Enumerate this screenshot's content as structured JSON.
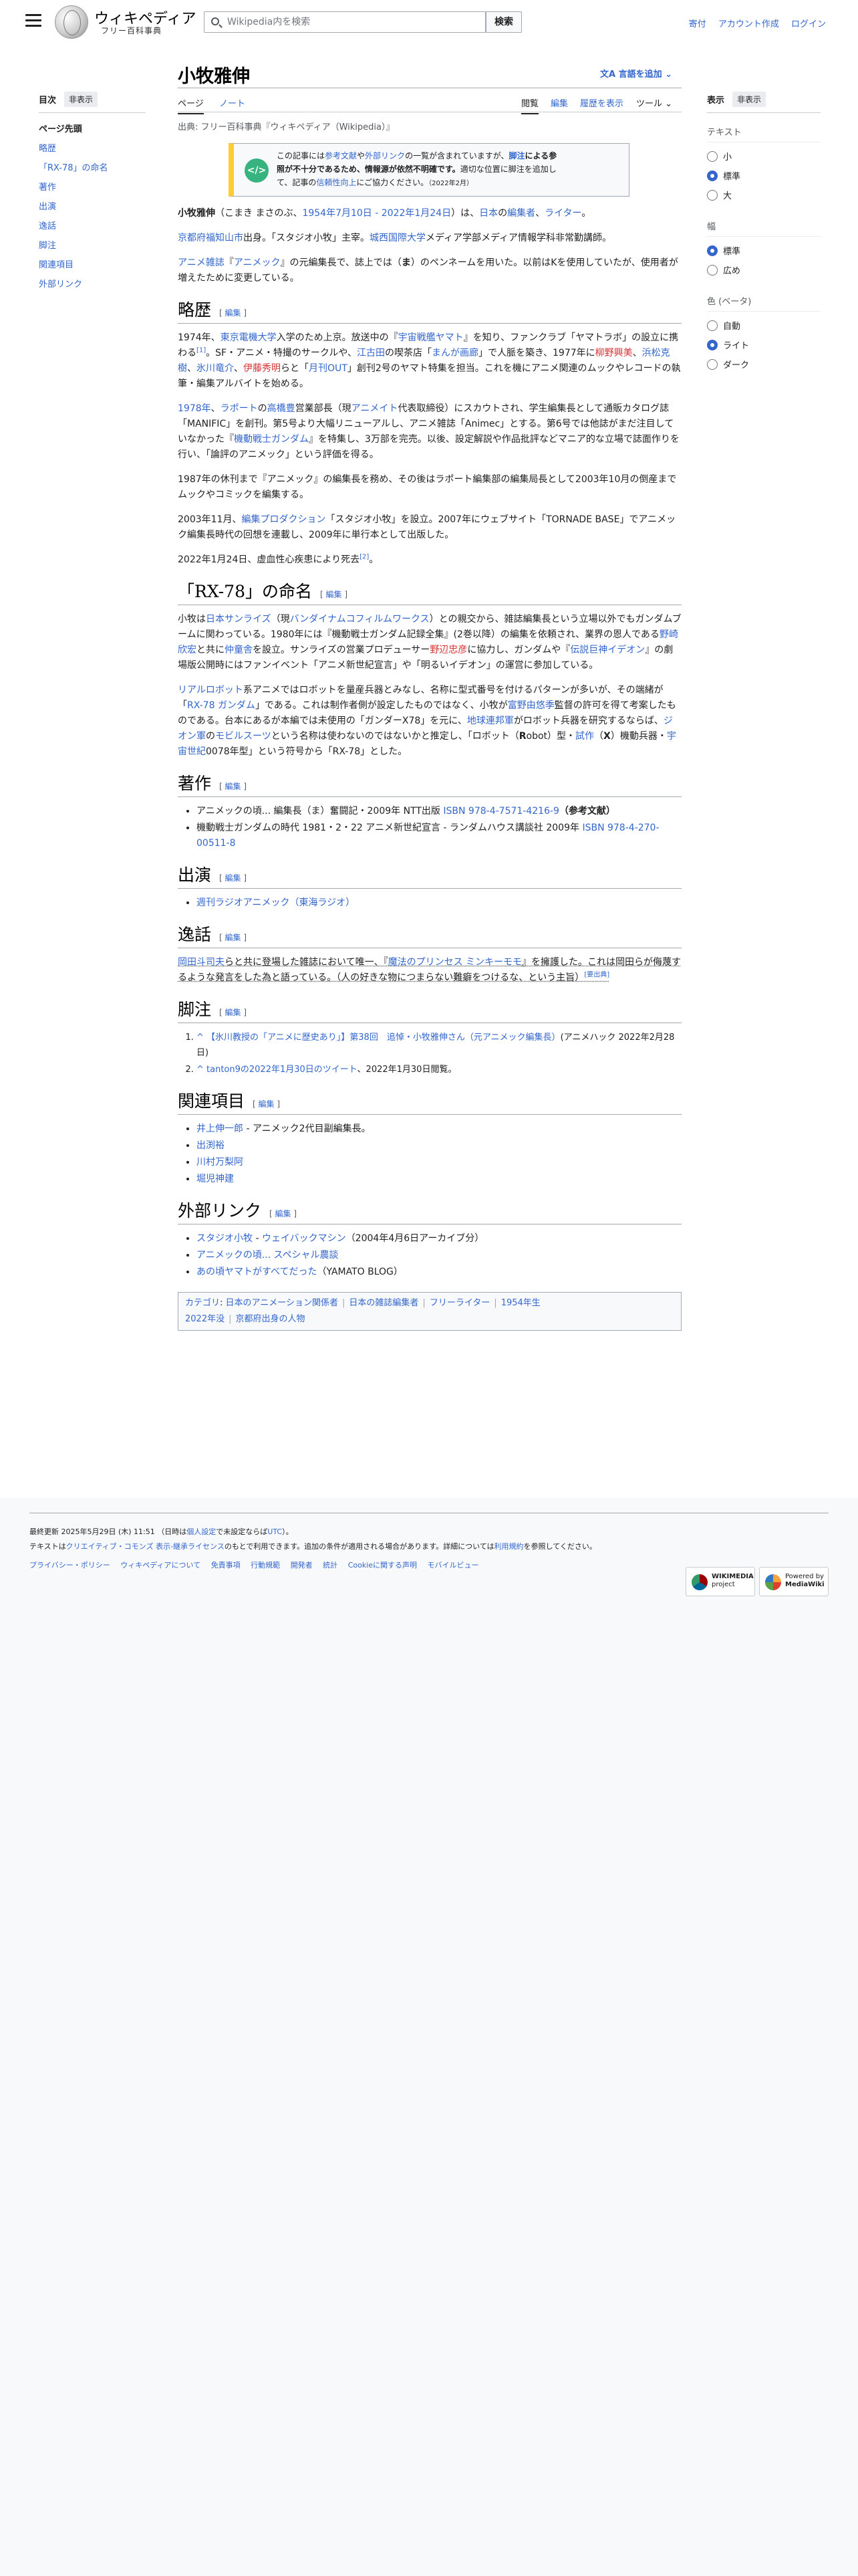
{
  "header": {
    "logo_title": "ウィキペディア",
    "logo_sub": "フリー百科事典",
    "search_placeholder": "Wikipedia内を検索",
    "search_button": "検索",
    "links": [
      "寄付",
      "アカウント作成",
      "ログイン"
    ]
  },
  "toc": {
    "title": "目次",
    "hide": "非表示",
    "items": [
      "ページ先頭",
      "略歴",
      "「RX-78」の命名",
      "著作",
      "出演",
      "逸話",
      "脚注",
      "関連項目",
      "外部リンク"
    ]
  },
  "display_panel": {
    "title": "表示",
    "hide": "非表示",
    "text_group": "テキスト",
    "text_options": [
      "小",
      "標準",
      "大"
    ],
    "width_group": "幅",
    "width_options": [
      "標準",
      "広め"
    ],
    "color_group": "色 (ベータ)",
    "color_options": [
      "自動",
      "ライト",
      "ダーク"
    ]
  },
  "article": {
    "title": "小牧雅伸",
    "lang_button": "言語を追加",
    "tabs": {
      "page": "ページ",
      "talk": "ノート",
      "read": "閲覧",
      "edit": "編集",
      "history": "履歴を表示",
      "tools": "ツール"
    },
    "source": "出典: フリー百科事典『ウィキペディア（Wikipedia）』",
    "notice": {
      "icon": "</>",
      "l1a": "この記事には",
      "l1b": "参考文献",
      "l1c": "や",
      "l1d": "外部リンク",
      "l1e": "の一覧が含まれていますが、",
      "l1f": "脚注",
      "l1g": "による参",
      "l2": "照が不十分であるため、情報源が依然不明確です。",
      "l2b": "適切な位置に脚注を追加し",
      "l3a": "て、記事の",
      "l3b": "信頼性向上",
      "l3c": "にご協力ください。",
      "date": "（2022年2月）"
    },
    "lead": {
      "name": "小牧雅伸",
      "reading": "（こまき まさのぶ、",
      "dates": "1954年7月10日 - 2022年1月24日",
      "mid": "）は、",
      "country": "日本",
      "of": "の",
      "job1": "編集者",
      "sep": "、",
      "job2": "ライター",
      "end": "。"
    },
    "p2": {
      "a": "京都府福知山市",
      "b": "出身。「スタジオ小牧」主宰。",
      "c": "城西国際大学",
      "d": "メディア学部メディア情報学科非常勤講師。"
    },
    "p3": {
      "a": "アニメ雑誌",
      "b": "『",
      "c": "アニメック",
      "d": "』の元編集長で、誌上では（",
      "e": "ま",
      "f": "）のペンネームを用いた。以前はKを使用していたが、使用者が増えたために変更している。"
    },
    "s1": {
      "h": "略歴",
      "edit": "編集",
      "p1a": "1974年、",
      "p1b": "東京電機大学",
      "p1c": "入学のため上京。放送中の『",
      "p1d": "宇宙戦艦ヤマト",
      "p1e": "』を知り、ファンクラブ「ヤマトラボ」の設立に携わる",
      "p1f": "[1]",
      "p1g": "。SF・アニメ・特撮のサークルや、",
      "p1h": "江古田",
      "p1i": "の喫茶店「",
      "p1j": "まんが画廊",
      "p1k": "」で人脈を築き、1977年に",
      "p1l": "柳野興美",
      "p1m": "、",
      "p1n": "浜松克樹",
      "p1o": "、",
      "p1p": "氷川竜介",
      "p1q": "、",
      "p1r": "伊藤秀明",
      "p1s": "らと「",
      "p1t": "月刊OUT",
      "p1u": "」創刊2号のヤマト特集を担当。これを機にアニメ関連のムックやレコードの執筆・編集アルバイトを始める。",
      "p2a": "1978年",
      "p2b": "、",
      "p2c": "ラポート",
      "p2d": "の",
      "p2e": "高橋豊",
      "p2f": "営業部長（現",
      "p2g": "アニメイト",
      "p2h": "代表取締役）にスカウトされ、学生編集長として通販カタログ誌「MANIFIC」を創刊。第5号より大幅リニューアルし、アニメ雑誌「Animec」とする。第6号では他誌がまだ注目していなかった『",
      "p2i": "機動戦士ガンダム",
      "p2j": "』を特集し、3万部を完売。以後、設定解説や作品批評などマニア的な立場で誌面作りを行い、「論評のアニメック」という評価を得る。",
      "p3": "1987年の休刊まで『アニメック』の編集長を務め、その後はラポート編集部の編集局長として2003年10月の倒産までムックやコミックを編集する。",
      "p4a": "2003年11月、",
      "p4b": "編集プロダクション",
      "p4c": "「スタジオ小牧」を設立。2007年にウェブサイト「TORNADE BASE」でアニメック編集長時代の回想を連載し、2009年に単行本として出版した。",
      "p5a": "2022年1月24日、虚血性心疾患により死去",
      "p5b": "[2]",
      "p5c": "。"
    },
    "s2": {
      "h": "「RX-78」の命名",
      "edit": "編集",
      "p1a": "小牧は",
      "p1b": "日本サンライズ",
      "p1c": "（現",
      "p1d": "バンダイナムコフィルムワークス",
      "p1e": "）との親交から、雑誌編集長という立場以外でもガンダムブームに関わっている。1980年には『機動戦士ガンダム記録全集』(2巻以降）の編集を依頼され、業界の恩人である",
      "p1f": "野崎欣宏",
      "p1g": "と共に",
      "p1h": "仲童舎",
      "p1i": "を設立。サンライズの営業プロデューサー",
      "p1j": "野辺忠彦",
      "p1k": "に協力し、ガンダムや『",
      "p1l": "伝説巨神イデオン",
      "p1m": "』の劇場版公開時にはファンイベント「アニメ新世紀宣言」や「明るいイデオン」の運営に参加している。",
      "p2a": "リアルロボット",
      "p2b": "系アニメではロボットを量産兵器とみなし、名称に型式番号を付けるパターンが多いが、その端緒が「",
      "p2c": "RX-78 ガンダム",
      "p2d": "」である。これは制作者側が設定したものではなく、小牧が",
      "p2e": "富野由悠季",
      "p2f": "監督の許可を得て考案したものである。台本にあるが本編では未使用の「ガンダーX78」を元に、",
      "p2g": "地球連邦軍",
      "p2h": "がロボット兵器を研究するならば、",
      "p2i": "ジオン軍",
      "p2j": "の",
      "p2k": "モビルスーツ",
      "p2l": "という名称は使わないのではないかと推定し、「ロボット（",
      "p2m": "R",
      "p2n": "obot）型・",
      "p2o": "試作",
      "p2p": "（",
      "p2q": "X",
      "p2r": "）機動兵器・",
      "p2s": "宇宙世紀",
      "p2t": "0078年型」という符号から「RX-78」とした。"
    },
    "s3": {
      "h": "著作",
      "edit": "編集",
      "i1a": "アニメックの頃... 編集長（ま）奮闘記・2009年 NTT出版 ",
      "i1b": "ISBN 978-4-7571-4216-9",
      "i1c": "（参考文献）",
      "i2a": "機動戦士ガンダムの時代 1981・2・22 アニメ新世紀宣言 - ランダムハウス講談社 2009年 ",
      "i2b": "ISBN 978-4-270-00511-8"
    },
    "s4": {
      "h": "出演",
      "edit": "編集",
      "i1": "週刊ラジオアニメック（東海ラジオ）"
    },
    "s5": {
      "h": "逸話",
      "edit": "編集",
      "p1a": "岡田斗司夫",
      "p1b": "らと共に登場した雑誌において唯一、『",
      "p1c": "魔法のプリンセス ミンキーモモ",
      "p1d": "』を擁護した。これは岡田らが侮蔑するような発言をした為と語っている。（人の好きな物につまらない難癖をつけるな、という主旨）",
      "p1e": "[要出典]"
    },
    "s6": {
      "h": "脚注",
      "edit": "編集",
      "r1a": "^ ",
      "r1b": "【氷川教授の「アニメに歴史あり」】第38回　追悼・小牧雅伸さん（元アニメック編集長）",
      "r1c": "(アニメハック 2022年2月28日)",
      "r2a": "^ ",
      "r2b": "tanton9の2022年1月30日のツイート",
      "r2c": "、2022年1月30日閲覧。"
    },
    "s7": {
      "h": "関連項目",
      "edit": "編集",
      "items": [
        "井上伸一郎",
        "出渕裕",
        "川村万梨阿",
        "堀児神建"
      ],
      "i1_suffix": " - アニメック2代目副編集長。"
    },
    "s8": {
      "h": "外部リンク",
      "edit": "編集",
      "i1a": "スタジオ小牧",
      "i1b": " - ",
      "i1c": "ウェイバックマシン",
      "i1d": "（2004年4月6日アーカイブ分）",
      "i2": "アニメックの頃... スペシャル農談",
      "i3a": "あの頃ヤマトがすべてだった",
      "i3b": "（YAMATO BLOG）"
    },
    "categories": {
      "label": "カテゴリ",
      "items": [
        "日本のアニメーション関係者",
        "日本の雑誌編集者",
        "フリーライター",
        "1954年生",
        "2022年没",
        "京都府出身の人物"
      ]
    }
  },
  "footer": {
    "updated_a": "最終更新 2025年5月29日 (木) 11:51 （日時は",
    "updated_b": "個人設定",
    "updated_c": "で未設定ならば",
    "updated_d": "UTC",
    "updated_e": "）。",
    "license_a": "テキストは",
    "license_b": "クリエイティブ・コモンズ 表示-継承ライセンス",
    "license_c": "のもとで利用できます。追加の条件が適用される場合があります。詳細については",
    "license_d": "利用規約",
    "license_e": "を参照してください。",
    "links": [
      "プライバシー・ポリシー",
      "ウィキペディアについて",
      "免責事項",
      "行動規範",
      "開発者",
      "統計",
      "Cookieに関する声明",
      "モバイルビュー"
    ],
    "badge1": [
      "WIKIMEDIA",
      "project"
    ],
    "badge2": [
      "Powered by",
      "MediaWiki"
    ]
  }
}
